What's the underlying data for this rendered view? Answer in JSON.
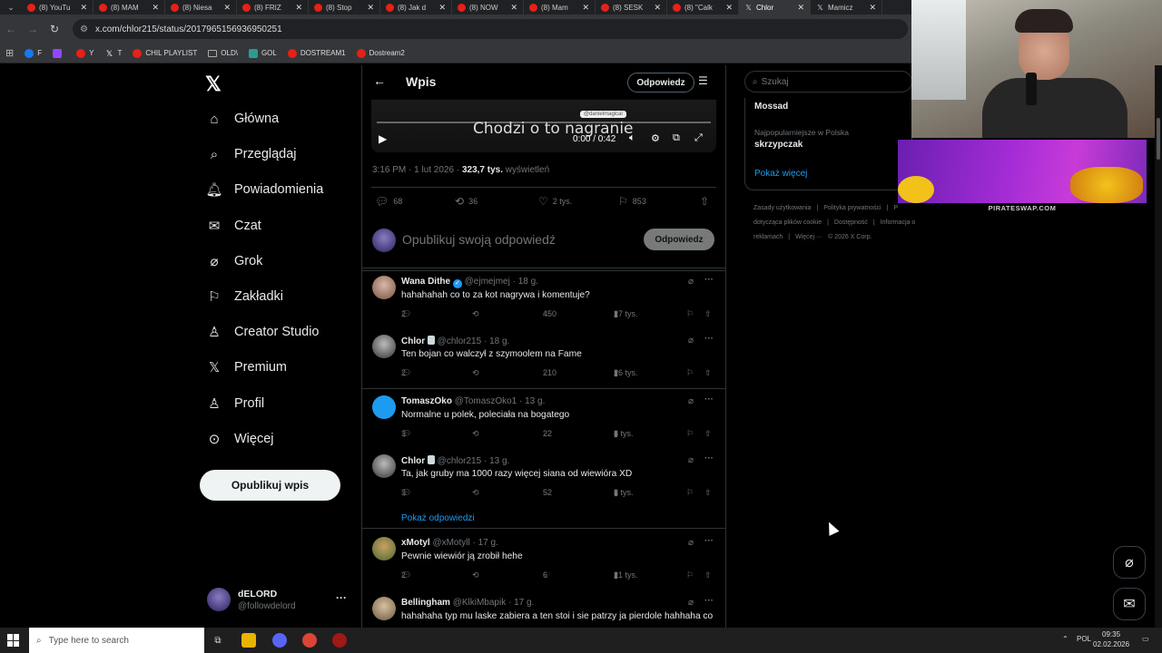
{
  "browser": {
    "tabs": [
      {
        "label": "(8) YouTu",
        "icon": "youtube-icon"
      },
      {
        "label": "(8) MAM",
        "icon": "youtube-icon"
      },
      {
        "label": "(8) Niesa",
        "icon": "youtube-icon"
      },
      {
        "label": "(8) FRIZ",
        "icon": "youtube-icon"
      },
      {
        "label": "(8) Stop",
        "icon": "youtube-icon"
      },
      {
        "label": "(8) Jak d",
        "icon": "youtube-icon"
      },
      {
        "label": "(8) NOW",
        "icon": "youtube-icon"
      },
      {
        "label": "(8) Mam",
        "icon": "youtube-icon"
      },
      {
        "label": "(8) SESK",
        "icon": "youtube-icon"
      },
      {
        "label": "(8) \"Calk",
        "icon": "youtube-icon"
      },
      {
        "label": "Chlor",
        "icon": "x-icon"
      },
      {
        "label": "Mamicz",
        "icon": "x-icon"
      }
    ],
    "url": "x.com/chlor215/status/2017965156936950251",
    "bookmarks": [
      {
        "label": "F",
        "icon": "facebook-icon"
      },
      {
        "label": "",
        "icon": "twitch-icon"
      },
      {
        "label": "Y",
        "icon": "youtube-icon"
      },
      {
        "label": "T",
        "icon": "x-icon"
      },
      {
        "label": "CHIL PLAYLIST",
        "icon": "youtube-icon"
      },
      {
        "label": "OLD\\",
        "icon": "folder-icon"
      },
      {
        "label": "GOL",
        "icon": "gol-icon"
      },
      {
        "label": "DOSTREAM1",
        "icon": "youtube-icon"
      },
      {
        "label": "Dostream2",
        "icon": "youtube-icon"
      }
    ]
  },
  "sidebar": {
    "items": [
      {
        "label": "Główna",
        "icon": "home-icon"
      },
      {
        "label": "Przeglądaj",
        "icon": "search-icon"
      },
      {
        "label": "Powiadomienia",
        "icon": "bell-icon"
      },
      {
        "label": "Czat",
        "icon": "mail-icon"
      },
      {
        "label": "Grok",
        "icon": "grok-icon"
      },
      {
        "label": "Zakładki",
        "icon": "bookmark-icon"
      },
      {
        "label": "Creator Studio",
        "icon": "creator-studio-icon"
      },
      {
        "label": "Premium",
        "icon": "x-icon"
      },
      {
        "label": "Profil",
        "icon": "person-icon"
      },
      {
        "label": "Więcej",
        "icon": "more-circle-icon"
      }
    ],
    "post_button": "Opublikuj wpis",
    "account": {
      "name": "dELORD",
      "handle": "@followdelord"
    }
  },
  "post": {
    "header_title": "Wpis",
    "reply_button": "Odpowiedz",
    "video": {
      "caption": "Chodzi o to nagranie",
      "watermark": "@danielmagical",
      "time": "0:00 / 0:42"
    },
    "meta": {
      "time": "3:16 PM · 1 lut 2026 · ",
      "views": "323,7 tys.",
      "views_label": " wyświetleń"
    },
    "stats": {
      "replies": "68",
      "reposts": "36",
      "likes": "2 tys.",
      "bookmarks": "853"
    },
    "compose_placeholder": "Opublikuj swoją odpowiedź",
    "compose_button": "Odpowiedz"
  },
  "replies": [
    {
      "name": "Wana Dithe",
      "handle": "@ejmejmej · 18 g.",
      "verified": true,
      "text": "hahahahah co to za kot nagrywa i komentuje?",
      "replies": "2",
      "likes": "450",
      "views": "27 tys."
    },
    {
      "name": "Chlor",
      "handle": "@chlor215 · 18 g.",
      "badge": true,
      "text": "Ten bojan co walczył z szymoolem na Fame",
      "replies": "2",
      "likes": "210",
      "views": "26 tys."
    },
    {
      "name": "TomaszOko",
      "handle": "@TomaszOko1 · 13 g.",
      "text": "Normalne u polek, poleciała na bogatego",
      "replies": "3",
      "likes": "22",
      "views": "8 tys."
    },
    {
      "name": "Chlor",
      "handle": "@chlor215 · 13 g.",
      "badge": true,
      "text": "Ta, jak gruby ma 1000 razy więcej siana od wiewióra XD",
      "replies": "3",
      "likes": "52",
      "views": "8 tys."
    },
    {
      "name": "xMotyl",
      "handle": "@xMotyll · 17 g.",
      "text": "Pewnie wiewiór ją zrobił hehe",
      "replies": "2",
      "likes": "6",
      "views": "21 tys."
    },
    {
      "name": "Bellingham",
      "handle": "@KlkiMbapik · 17 g.",
      "text": "hahahaha typ mu laske zabiera a ten stoi i sie patrzy ja pierdole hahhaha co",
      "replies": "",
      "likes": "",
      "views": ""
    }
  ],
  "show_replies": "Pokaż odpowiedzi",
  "right": {
    "search_placeholder": "Szukaj",
    "trend1": "Mossad",
    "trend_label": "Najpopularniejsze w Polska",
    "trend2": "skrzypczak",
    "show_more": "Pokaż więcej",
    "footer": [
      "Zasady użytkowania",
      "|",
      "Polityka prywatności",
      "|",
      "Polityka dotycząca plików cookie",
      "|",
      "Dostępność",
      "|",
      "Informacja o reklamach",
      "|",
      "Więcej ···",
      "© 2026 X Corp."
    ]
  },
  "overlay": {
    "ad_label": "PIRATESWAP.COM"
  },
  "taskbar": {
    "search": "Type here to search",
    "lang": "POL",
    "time": "09:35",
    "date": "02.02.2026"
  },
  "colors": {
    "accent": "#1d9bf0",
    "bg": "#000000",
    "text": "#e7e9ea",
    "muted": "#71767b",
    "border": "#2f3336"
  }
}
